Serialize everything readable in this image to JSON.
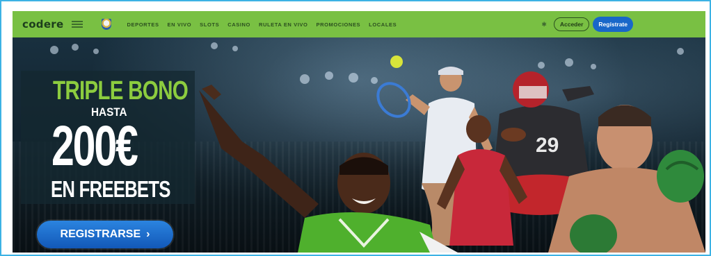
{
  "navbar": {
    "logo": "codere",
    "nav_links": [
      "DEPORTES",
      "EN VIVO",
      "SLOTS",
      "CASINO",
      "RULETA EN VIVO",
      "PROMOCIONES",
      "LOCALES"
    ],
    "login_label": "Acceder",
    "register_label": "Regístrate",
    "accent_color": "#79c043"
  },
  "hero": {
    "line1": "TRIPLE BONO",
    "line2": "HASTA",
    "amount": "200€",
    "line4": "EN FREEBETS",
    "cta_label": "REGISTRARSE",
    "cta_arrow": "›",
    "cta_color": "#1a67c9",
    "highlight_color": "#8ccc3f"
  },
  "icons": {
    "partner_badge": "partner-badge-icon",
    "club_crest": "club-crest-icon",
    "settings": "settings-icon"
  }
}
